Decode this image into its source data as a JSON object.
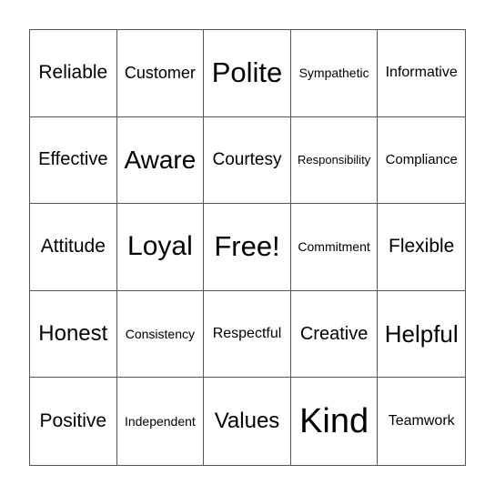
{
  "board": {
    "rows": [
      [
        "Reliable",
        "Customer",
        "Polite",
        "Sympathetic",
        "Informative"
      ],
      [
        "Effective",
        "Aware",
        "Courtesy",
        "Responsibility",
        "Compliance"
      ],
      [
        "Attitude",
        "Loyal",
        "Free!",
        "Commitment",
        "Flexible"
      ],
      [
        "Honest",
        "Consistency",
        "Respectful",
        "Creative",
        "Helpful"
      ],
      [
        "Positive",
        "Independent",
        "Values",
        "Kind",
        "Teamwork"
      ]
    ],
    "free_space": "Free!"
  }
}
